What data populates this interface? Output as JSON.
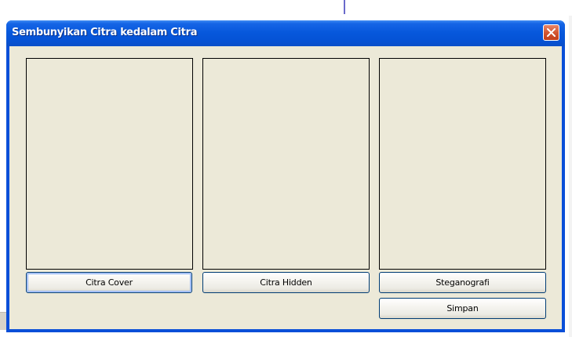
{
  "window": {
    "title": "Sembunyikan Citra kedalam Citra"
  },
  "panels": [
    {
      "name": "cover"
    },
    {
      "name": "hidden"
    },
    {
      "name": "result"
    }
  ],
  "buttons": {
    "cover": "Citra Cover",
    "hidden": "Citra Hidden",
    "stego": "Steganografi",
    "save": "Simpan"
  },
  "colors": {
    "titlebar": "#0758dc",
    "client_background": "#ece9d8",
    "close_button": "#d45732"
  },
  "icons": {
    "close": "close-icon"
  }
}
